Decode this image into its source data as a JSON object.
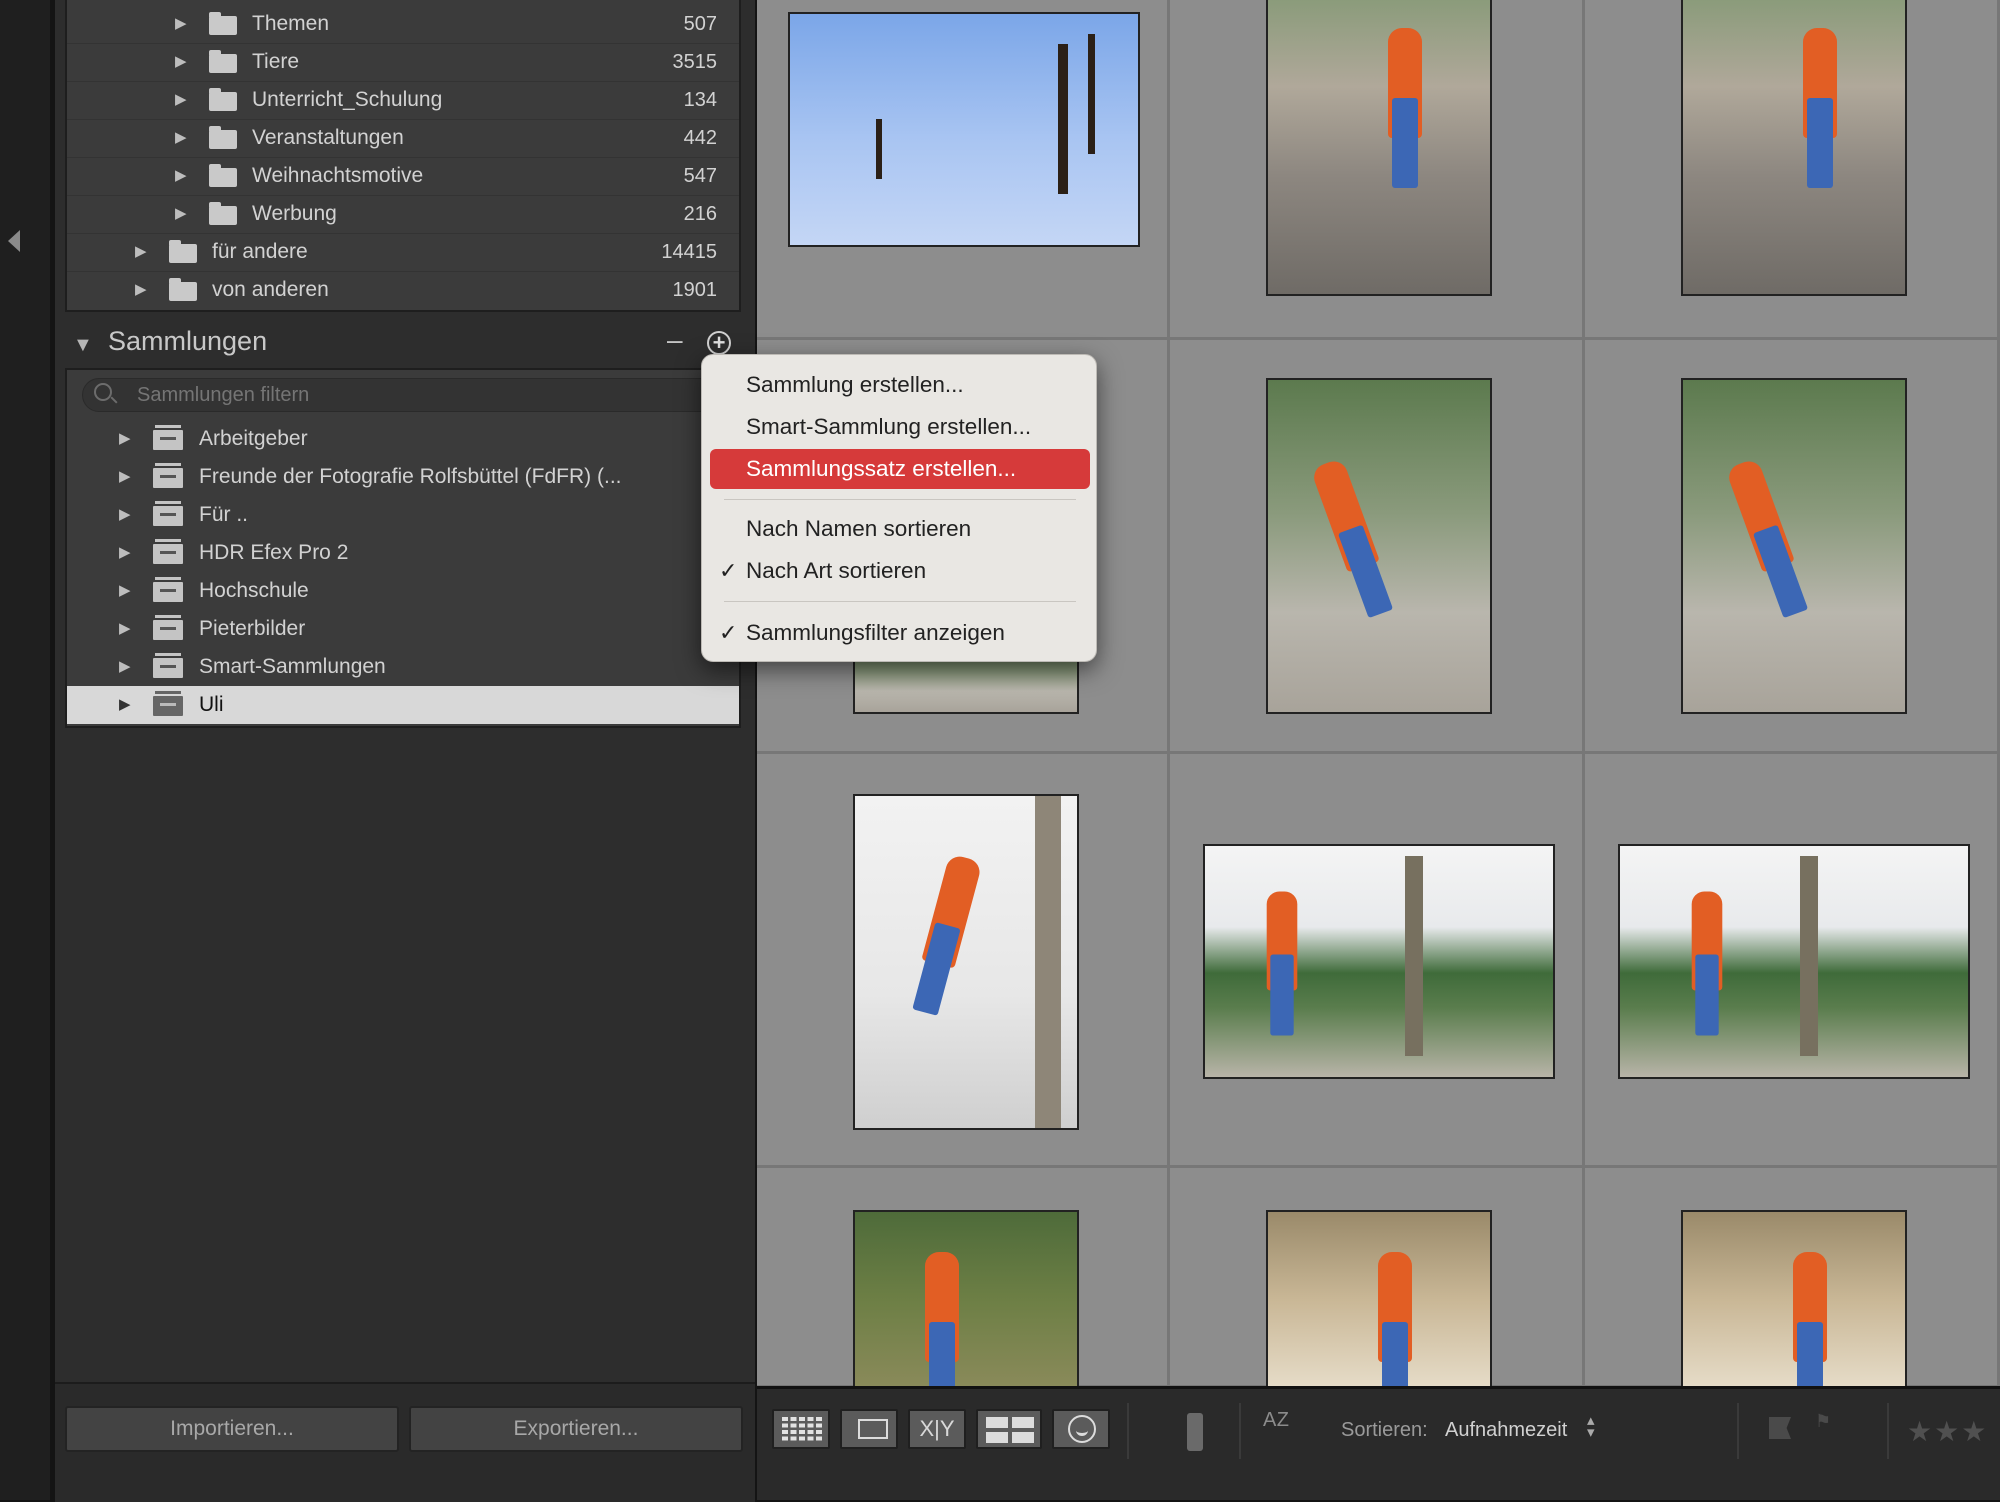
{
  "folders": [
    {
      "label": "Themen",
      "count": "507",
      "level": 2
    },
    {
      "label": "Tiere",
      "count": "3515",
      "level": 2
    },
    {
      "label": "Unterricht_Schulung",
      "count": "134",
      "level": 2
    },
    {
      "label": "Veranstaltungen",
      "count": "442",
      "level": 2
    },
    {
      "label": "Weihnachtsmotive",
      "count": "547",
      "level": 2
    },
    {
      "label": "Werbung",
      "count": "216",
      "level": 2
    },
    {
      "label": "für andere",
      "count": "14415",
      "level": 1
    },
    {
      "label": "von anderen",
      "count": "1901",
      "level": 1
    }
  ],
  "collections": {
    "title": "Sammlungen",
    "filter_placeholder": "Sammlungen filtern",
    "items": [
      {
        "label": "Arbeitgeber"
      },
      {
        "label": "Freunde der Fotografie Rolfsbüttel (FdFR) (..."
      },
      {
        "label": "Für .."
      },
      {
        "label": "HDR Efex Pro 2"
      },
      {
        "label": "Hochschule"
      },
      {
        "label": "Pieterbilder"
      },
      {
        "label": "Smart-Sammlungen"
      },
      {
        "label": "Uli",
        "selected": true
      }
    ]
  },
  "buttons": {
    "import": "Importieren...",
    "export": "Exportieren..."
  },
  "menu": {
    "items": [
      {
        "label": "Sammlung erstellen...",
        "checked": false,
        "highlighted": false
      },
      {
        "label": "Smart-Sammlung erstellen...",
        "checked": false,
        "highlighted": false
      },
      {
        "label": "Sammlungssatz erstellen...",
        "checked": false,
        "highlighted": true
      },
      {
        "label": "Nach Namen sortieren",
        "checked": false,
        "highlighted": false
      },
      {
        "label": "Nach Art sortieren",
        "checked": true,
        "highlighted": false
      },
      {
        "label": "Sammlungsfilter anzeigen",
        "checked": true,
        "highlighted": false
      }
    ]
  },
  "toolbar": {
    "sort_label": "Sortieren:",
    "sort_value": "Aufnahmezeit",
    "compare_label": "X|Y",
    "az_label": "A Z",
    "stars": "★★★"
  },
  "colors": {
    "highlight": "#d63a3a",
    "panel": "#2d2d2d",
    "grid": "#8d8d8d"
  },
  "icons": [
    "folder-icon",
    "collection-set-icon",
    "search-icon",
    "grid-view-icon",
    "loupe-view-icon",
    "compare-view-icon",
    "survey-view-icon",
    "people-view-icon",
    "spray-can-icon",
    "sort-direction-icon",
    "flag-icon",
    "reject-flag-icon",
    "star-icon"
  ]
}
